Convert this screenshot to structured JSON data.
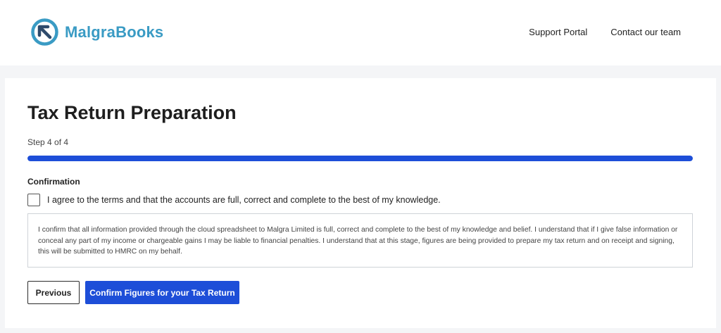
{
  "header": {
    "brand": "MalgraBooks",
    "logo_icon": "arrow-up-left-circle-icon",
    "nav": [
      {
        "label": "Support Portal"
      },
      {
        "label": "Contact our team"
      }
    ]
  },
  "form": {
    "title": "Tax Return Preparation",
    "step_text": "Step 4 of 4",
    "progress_fraction": 1.0,
    "section_label": "Confirmation",
    "agree_label": "I agree to the terms and that the accounts are full, correct and complete to the best of my knowledge.",
    "agree_checked": false,
    "declaration": "I confirm that all information provided through the cloud spreadsheet to Malgra Limited is full, correct and complete to the best of my knowledge and belief. I understand that if I give false information or conceal any part of my income or chargeable gains I may be liable to financial penalties. I understand that at this stage, figures are being provided to prepare my tax return and on receipt and signing, this will be submitted to HMRC on my behalf.",
    "previous_label": "Previous",
    "confirm_label": "Confirm Figures for your Tax Return"
  },
  "colors": {
    "brand": "#3a9bc4",
    "accent": "#1d4ed8",
    "background": "#f4f5f7"
  }
}
